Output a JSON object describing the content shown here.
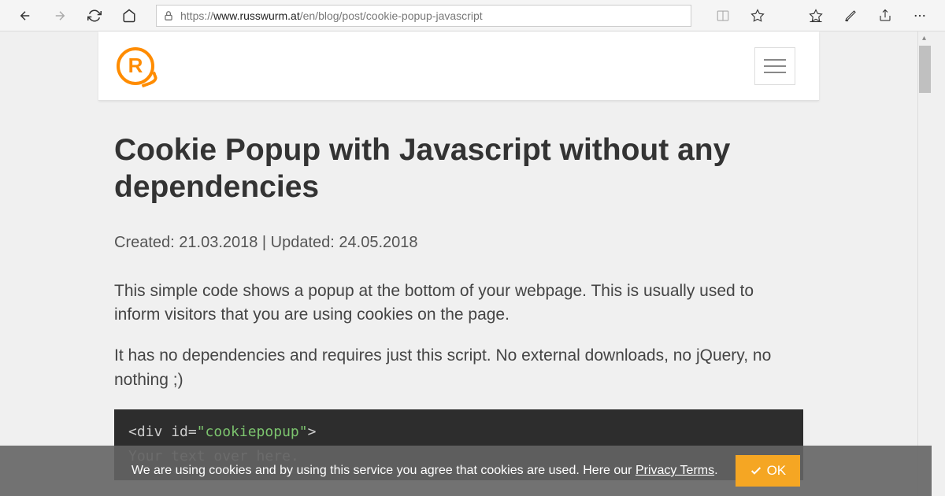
{
  "browser": {
    "url_prefix": "https://",
    "url_domain": "www.russwurm.at",
    "url_path": "/en/blog/post/cookie-popup-javascript"
  },
  "site": {
    "logo_letter": "R"
  },
  "article": {
    "title": "Cookie Popup with Javascript without any dependencies",
    "meta": "Created: 21.03.2018 | Updated: 24.05.2018",
    "para1": "This simple code shows a popup at the bottom of your webpage. This is usually used to inform visitors that you are using cookies on the page.",
    "para2": "It has no dependencies and requires just this script. No external downloads, no jQuery, no nothing ;)",
    "code_line1_a": "<div ",
    "code_line1_b": "id=",
    "code_line1_c": "\"cookiepopup\"",
    "code_line1_d": ">",
    "code_line2": "Your text over here."
  },
  "cookie": {
    "text": "We are using cookies and by using this service you agree that cookies are used. Here our ",
    "link": "Privacy Terms",
    "after": ".",
    "ok": "OK"
  }
}
